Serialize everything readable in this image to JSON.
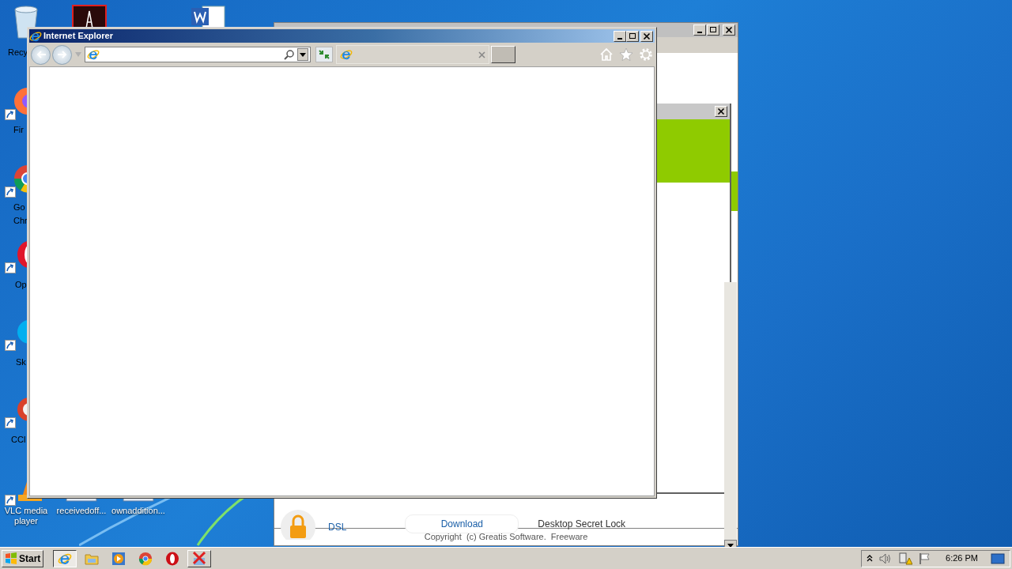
{
  "desktop": {
    "icons": [
      {
        "kind": "recycle",
        "label": "Recy"
      },
      {
        "kind": "pdf"
      },
      {
        "kind": "word"
      },
      {
        "kind": "firefox",
        "label": "Fir"
      },
      {
        "kind": "chrome",
        "label": "Go Chr"
      },
      {
        "kind": "opera",
        "label": "Op"
      },
      {
        "kind": "skype",
        "label": "Sk"
      },
      {
        "kind": "ccleaner",
        "label": "CCl"
      },
      {
        "kind": "vlc",
        "label": "VLC media player"
      },
      {
        "kind": "file",
        "label": "receivedoff..."
      },
      {
        "kind": "file",
        "label": "ownaddition..."
      }
    ]
  },
  "background_window": {
    "row": {
      "label": "DSL",
      "button": "Download",
      "title": "Desktop Secret Lock"
    },
    "footer": "Copyright  (c) Greatis Software.  Freeware"
  },
  "browser": {
    "title": "Internet Explorer"
  },
  "taskbar": {
    "start": "Start",
    "items": [
      {
        "kind": "ie",
        "selected": true
      },
      {
        "kind": "explorer",
        "selected": false
      },
      {
        "kind": "media",
        "selected": false
      },
      {
        "kind": "chrome",
        "selected": false
      },
      {
        "kind": "opera",
        "selected": false
      },
      {
        "kind": "app",
        "selected": false
      }
    ],
    "clock": "6:26 PM"
  }
}
